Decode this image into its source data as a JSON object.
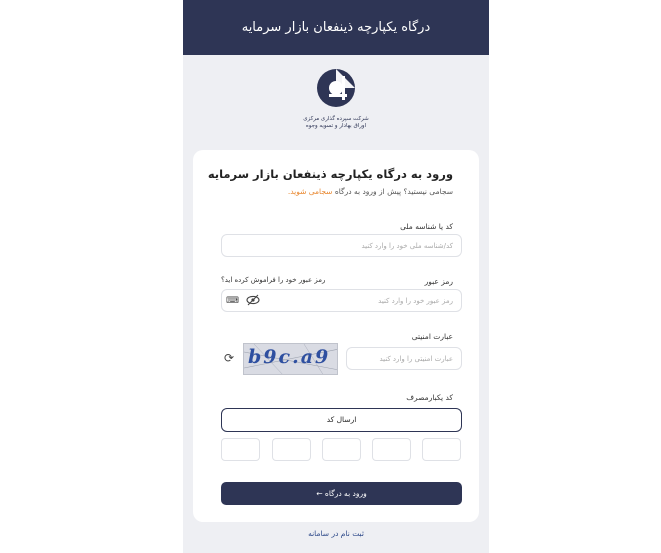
{
  "header": {
    "title": "درگاه یکپارچه ذینفعان بازار سرمایه"
  },
  "logo": {
    "text_line1": "شرکت سپرده گذاری مرکزی",
    "text_line2": "اوراق بهادار و تسویه وجوه"
  },
  "card": {
    "title": "ورود به درگاه یکپارچه ذینفعان بازار سرمایه",
    "subtitle_prefix": "سجامی نیستید؟ پیش از ورود به درگاه",
    "subtitle_link": "سجامی شوید."
  },
  "fields": {
    "national_id": {
      "label": "کد یا شناسه ملی",
      "placeholder": "کد/شناسه ملی خود را وارد کنید"
    },
    "password": {
      "label": "رمز عبور",
      "forgot": "رمز عبور خود را فراموش کرده اید؟",
      "placeholder": "رمز عبور خود را وارد کنید"
    },
    "captcha": {
      "label": "عبارت امنیتی",
      "placeholder": "عبارت امنیتی را وارد کنید",
      "image_text": "b9c.a9"
    },
    "otp": {
      "label": "کد یکبارمصرف",
      "send_label": "ارسال کد"
    }
  },
  "actions": {
    "submit_label": "ورود به درگاه ←",
    "register_label": "ثبت نام در سامانه"
  },
  "colors": {
    "primary": "#2e3555",
    "accent": "#e8862d",
    "background": "#eeeff3"
  }
}
